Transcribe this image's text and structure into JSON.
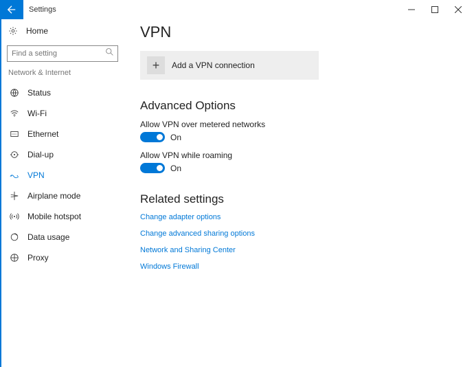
{
  "window": {
    "title": "Settings"
  },
  "sidebar": {
    "home": "Home",
    "search_placeholder": "Find a setting",
    "group": "Network & Internet",
    "items": [
      {
        "label": "Status"
      },
      {
        "label": "Wi-Fi"
      },
      {
        "label": "Ethernet"
      },
      {
        "label": "Dial-up"
      },
      {
        "label": "VPN",
        "active": true
      },
      {
        "label": "Airplane mode"
      },
      {
        "label": "Mobile hotspot"
      },
      {
        "label": "Data usage"
      },
      {
        "label": "Proxy"
      }
    ]
  },
  "main": {
    "title": "VPN",
    "add_label": "Add a VPN connection",
    "advanced_heading": "Advanced Options",
    "options": [
      {
        "label": "Allow VPN over metered networks",
        "state": "On",
        "value": true
      },
      {
        "label": "Allow VPN while roaming",
        "state": "On",
        "value": true
      }
    ],
    "related_heading": "Related settings",
    "links": [
      "Change adapter options",
      "Change advanced sharing options",
      "Network and Sharing Center",
      "Windows Firewall"
    ]
  },
  "colors": {
    "accent": "#0078d7"
  }
}
